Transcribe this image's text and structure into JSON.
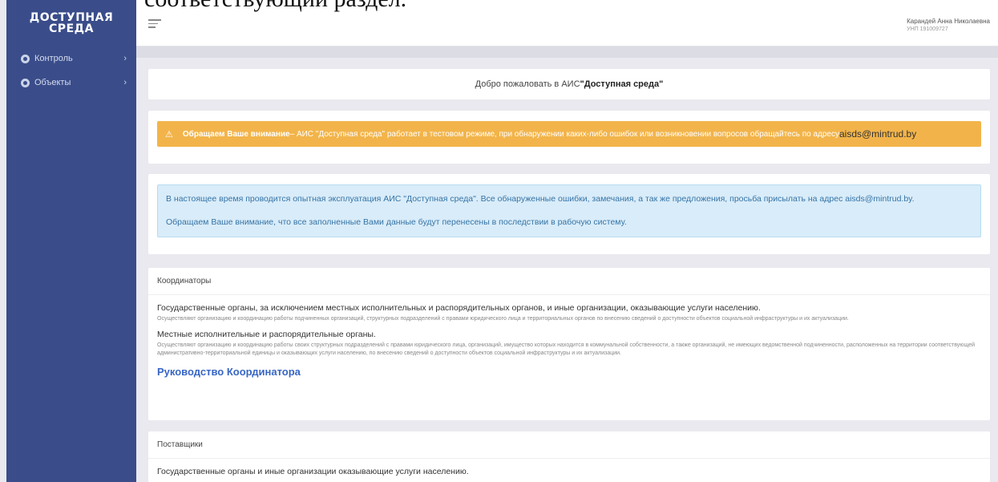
{
  "overflow_text": "соответствующий раздел.",
  "logo": {
    "line1": "ДОСТУПНАЯ",
    "line2": "СРЕДА"
  },
  "sidebar": {
    "items": [
      {
        "label": "Контроль",
        "icon": "circle-icon"
      },
      {
        "label": "Объекты",
        "icon": "circle-icon"
      }
    ]
  },
  "header": {
    "user_name": "Карандей Анна Николаевна",
    "user_id": "УНП 191009727"
  },
  "welcome": {
    "prefix": "Добро пожаловать в АИС ",
    "name": "\"Доступная среда\""
  },
  "warning": {
    "strong": "Обращаем Ваше внимание",
    "text": " – АИС \"Доступная среда\" работает в тестовом режиме, при обнаружении каких-либо ошибок или возникновении вопросов обращайтесь по адресу ",
    "email": "aisds@mintrud.by"
  },
  "info": {
    "line1": "В настоящее время проводится опытная эксплуатация АИС \"Доступная среда\". Все обнаруженные ошибки, замечания, а так же предложения, просьба присылать на адрес aisds@mintrud.by.",
    "line2": "Обращаем Ваше внимание, что все заполненные Вами данные будут перенесены в последствии в рабочую систему."
  },
  "coordinators": {
    "heading": "Координаторы",
    "blocks": [
      {
        "title": "Государственные органы, за исключением местных исполнительных и распорядительных органов, и иные организации, оказывающие услуги населению.",
        "desc": "Осуществляют организацию и координацию работы подчиненных организаций, структурных подразделений с правами юридического лица и территориальных органов по внесению сведений о доступности объектов социальной инфраструктуры и их актуализации."
      },
      {
        "title": "Местные исполнительные и распорядительные органы.",
        "desc": "Осуществляют организацию и координацию работы своих структурных подразделений с правами юридического лица, организаций, имущество которых находится в коммунальной собственности, а также организаций, не имеющих ведомственной подчиненности, расположенных на территории соответствующей административно-территориальной единицы и оказывающих услуги населению, по внесению сведений о доступности объектов социальной инфраструктуры и их актуализации."
      }
    ],
    "guide_link": "Руководство Координатора"
  },
  "providers": {
    "heading": "Поставщики",
    "title": "Государственные органы и иные организации оказывающие услуги населению."
  }
}
